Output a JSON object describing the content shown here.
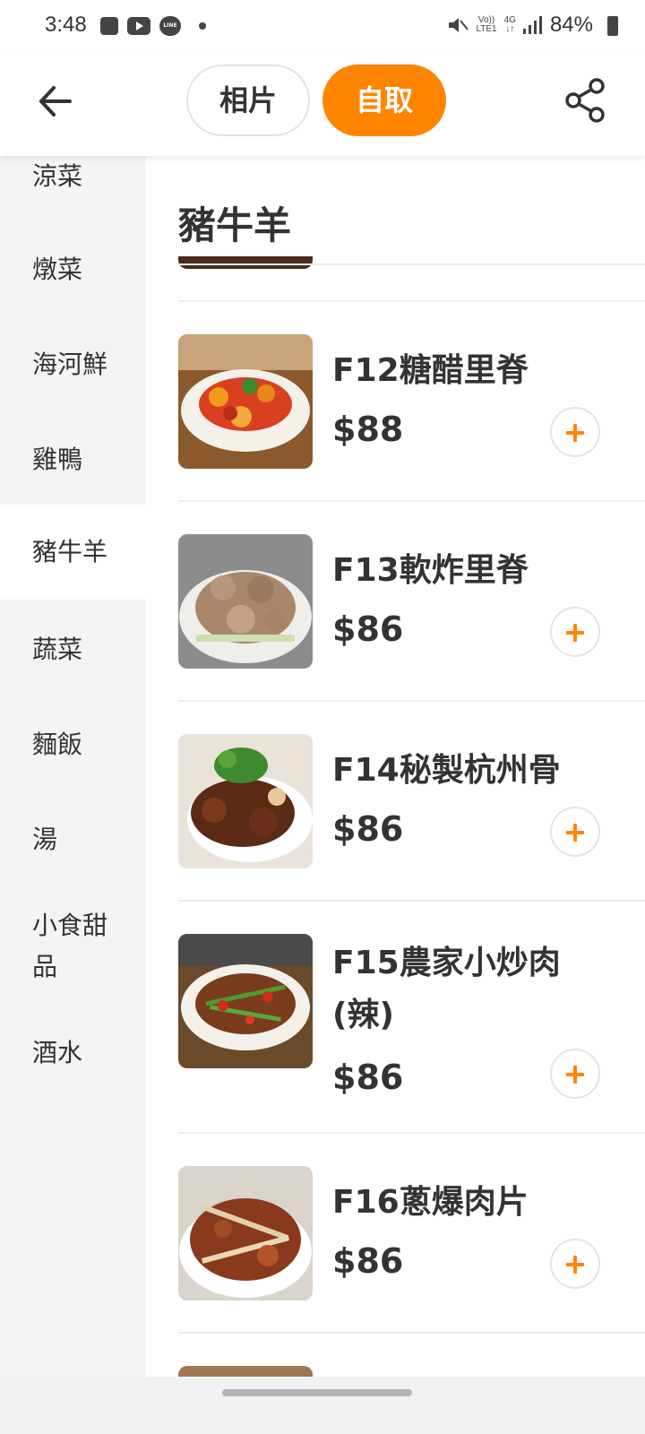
{
  "status_bar": {
    "time": "3:48",
    "line_label": "LINE",
    "volte_label": "Vo))",
    "lte_label": "LTE1",
    "network_label": "4G",
    "battery": "84%"
  },
  "header": {
    "tabs": [
      {
        "label": "相片"
      },
      {
        "label": "自取"
      }
    ]
  },
  "sidebar": {
    "items": [
      {
        "label": "涼菜"
      },
      {
        "label": "燉菜"
      },
      {
        "label": "海河鮮"
      },
      {
        "label": "雞鴨"
      },
      {
        "label": "豬牛羊"
      },
      {
        "label": "蔬菜"
      },
      {
        "label": "麵飯"
      },
      {
        "label": "湯"
      },
      {
        "label": "小食甜品"
      },
      {
        "label": "酒水"
      }
    ]
  },
  "main": {
    "section_title": "豬牛羊",
    "items": [
      {
        "name": "F12糖醋里脊",
        "price": "$88"
      },
      {
        "name": "F13軟炸里脊",
        "price": "$86"
      },
      {
        "name": "F14秘製杭州骨",
        "price": "$86"
      },
      {
        "name": "F15農家小炒肉(辣)",
        "price": "$86"
      },
      {
        "name": "F16蔥爆肉片",
        "price": "$86"
      }
    ]
  },
  "colors": {
    "accent": "#ff8400",
    "sidebar_bg": "#f6f3f6",
    "text": "#333333"
  }
}
